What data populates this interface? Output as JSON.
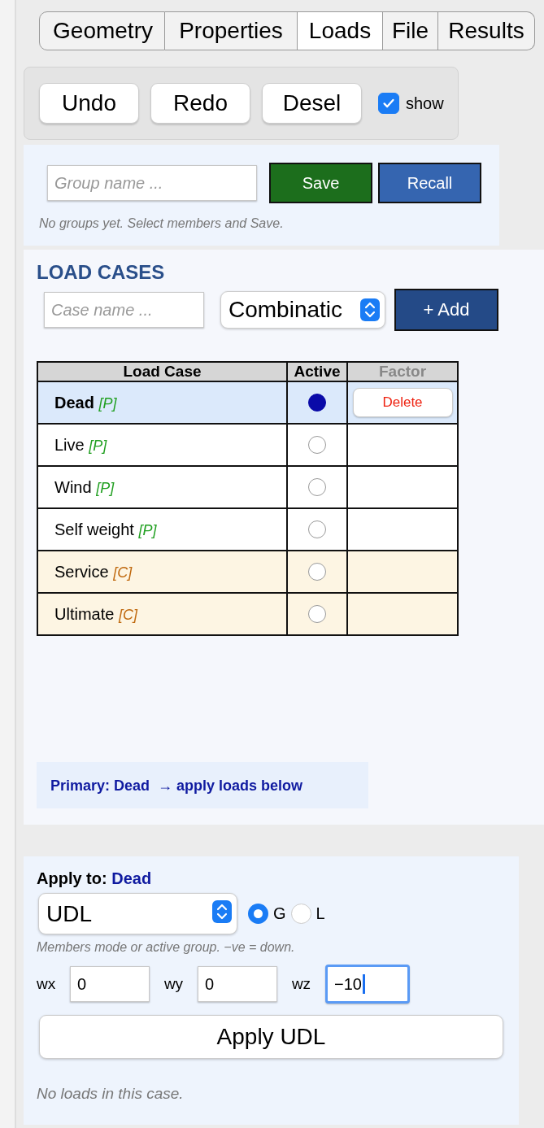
{
  "tabs": [
    {
      "label": "Geometry",
      "selected": false
    },
    {
      "label": "Properties",
      "selected": false
    },
    {
      "label": "Loads",
      "selected": true
    },
    {
      "label": "File",
      "selected": false
    },
    {
      "label": "Results",
      "selected": false
    }
  ],
  "toolbar": {
    "buttons": [
      "Undo",
      "Redo",
      "Desel"
    ],
    "show": {
      "label": "show",
      "checked": true
    }
  },
  "groups": {
    "placeholder": "Group name ...",
    "save": "Save",
    "recall": "Recall",
    "hint": "No groups yet. Select members and Save."
  },
  "load_cases": {
    "title": "LOAD CASES",
    "placeholder": "Case name ...",
    "type": "Combinatic",
    "add": "+ Add",
    "columns": [
      {
        "label": "Load Case",
        "dimmed": false
      },
      {
        "label": "Active",
        "dimmed": false
      },
      {
        "label": "Factor",
        "dimmed": true
      }
    ],
    "rows": [
      {
        "name": "Dead",
        "tag": "[P]",
        "kind": "primary",
        "selected": true,
        "active": true
      },
      {
        "name": "Live",
        "tag": "[P]",
        "kind": "primary",
        "selected": false,
        "active": false
      },
      {
        "name": "Wind",
        "tag": "[P]",
        "kind": "primary",
        "selected": false,
        "active": false
      },
      {
        "name": "Self weight",
        "tag": "[P]",
        "kind": "primary",
        "selected": false,
        "active": false
      },
      {
        "name": "Service",
        "tag": "[C]",
        "kind": "combination",
        "selected": false,
        "active": false
      },
      {
        "name": "Ultimate",
        "tag": "[C]",
        "kind": "combination",
        "selected": false,
        "active": false
      }
    ],
    "delete": "Delete",
    "note": {
      "label": "Primary:",
      "case": "Dead",
      "text": "→ apply loads below"
    }
  },
  "apply": {
    "label": "Apply to:",
    "case": "Dead",
    "load_type": "UDL",
    "axes": [
      {
        "label": "G",
        "selected": true
      },
      {
        "label": "L",
        "selected": false
      }
    ],
    "hint": "Members mode or active group.  −ve = down.",
    "fields": [
      {
        "label": "wx",
        "value": "0",
        "focused": false
      },
      {
        "label": "wy",
        "value": "0",
        "focused": false
      },
      {
        "label": "wz",
        "value": "−10",
        "focused": true
      }
    ],
    "button": "Apply UDL",
    "empty": "No loads in this case."
  }
}
